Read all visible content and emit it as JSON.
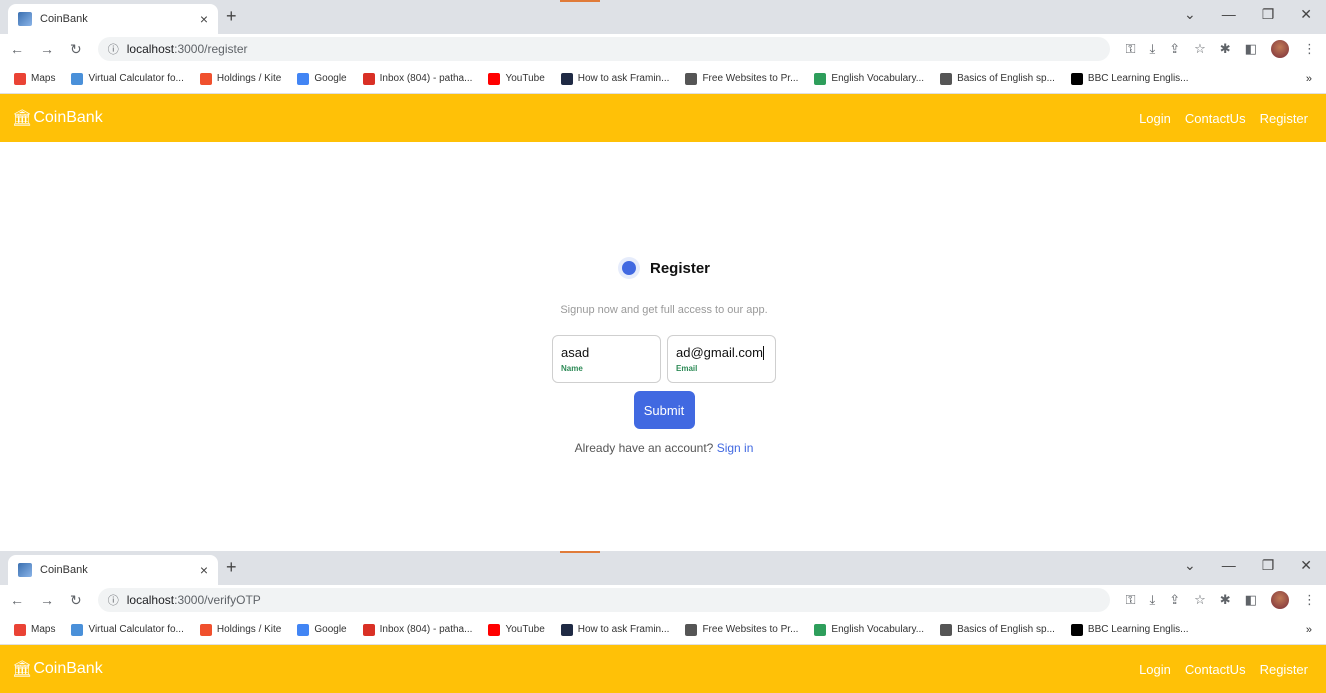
{
  "browser_top": {
    "tab_title": "CoinBank",
    "tab_close": "×",
    "new_tab": "+",
    "url_host": "localhost",
    "url_path": ":3000/register"
  },
  "browser_bottom": {
    "tab_title": "CoinBank",
    "tab_close": "×",
    "new_tab": "+",
    "url_host": "localhost",
    "url_path": ":3000/verifyOTP"
  },
  "window_controls": {
    "dropdown": "⌄",
    "minimize": "—",
    "restore": "❐",
    "close": "✕"
  },
  "bookmarks": [
    {
      "label": "Maps",
      "icon": "maps-pin-icon",
      "color": "#ea4335"
    },
    {
      "label": "Virtual Calculator fo...",
      "icon": "calculator-icon",
      "color": "#4a90d9"
    },
    {
      "label": "Holdings / Kite",
      "icon": "kite-icon",
      "color": "#f0502d"
    },
    {
      "label": "Google",
      "icon": "google-icon",
      "color": "#4285f4"
    },
    {
      "label": "Inbox (804) - patha...",
      "icon": "gmail-icon",
      "color": "#d93025"
    },
    {
      "label": "YouTube",
      "icon": "youtube-icon",
      "color": "#ff0000"
    },
    {
      "label": "How to ask Framin...",
      "icon": "bookmark-dark-icon",
      "color": "#1f2a44"
    },
    {
      "label": "Free Websites to Pr...",
      "icon": "web-icon",
      "color": "#555555"
    },
    {
      "label": "English Vocabulary...",
      "icon": "globe-icon",
      "color": "#2e9e5b"
    },
    {
      "label": "Basics of English sp...",
      "icon": "globe-dark-icon",
      "color": "#555555"
    },
    {
      "label": "BBC Learning Englis...",
      "icon": "bbc-icon",
      "color": "#000000"
    }
  ],
  "bookmarks_more": "»",
  "app": {
    "brand": "CoinBank",
    "brand_icon": "🏛",
    "nav": {
      "login": "Login",
      "contact": "ContactUs",
      "register": "Register"
    },
    "colors": {
      "navbar": "#ffc107",
      "accent": "#4169e1",
      "field_label": "#2e8b57"
    }
  },
  "form": {
    "title": "Register",
    "subtitle": "Signup now and get full access to our app.",
    "name_value": "asad",
    "name_label": "Name",
    "email_value": "ad@gmail.com",
    "email_label": "Email",
    "submit_label": "Submit",
    "signin_prompt": "Already have an account?",
    "signin_link": "Sign in"
  }
}
